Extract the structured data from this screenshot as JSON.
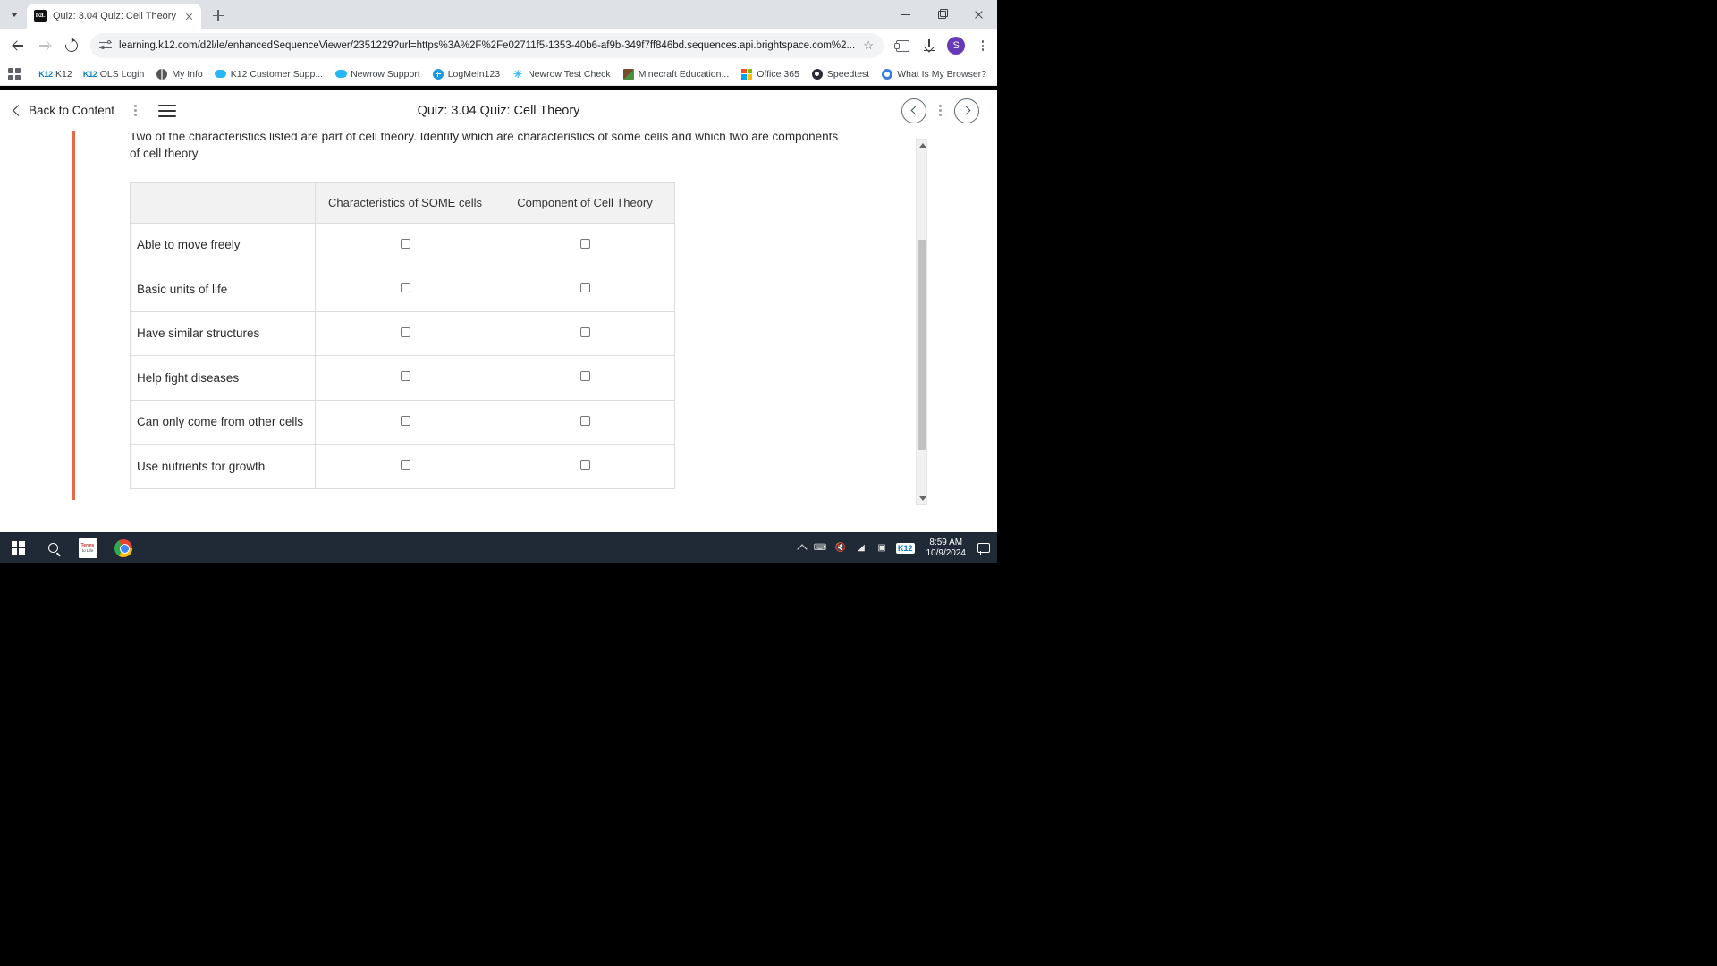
{
  "browser": {
    "tab": {
      "title": "Quiz: 3.04 Quiz: Cell Theory",
      "favicon_label": "D2L",
      "favicon_name": "d2l-favicon"
    },
    "new_tab_label": "+",
    "window_controls": {
      "minimize": "minimize",
      "maximize": "maximize",
      "close": "close"
    },
    "nav": {
      "back": "back",
      "forward": "forward",
      "reload": "reload"
    },
    "omnibox": {
      "url": "learning.k12.com/d2l/le/enhancedSequenceViewer/2351229?url=https%3A%2F%2Fe02711f5-1353-40b6-af9b-349f7ff846bd.sequences.api.brightspace.com%2...",
      "site_info_icon": "site-settings-icon",
      "star_label": "☆"
    },
    "actions": {
      "extensions": "extensions",
      "downloads": "downloads",
      "profile_initial": "S",
      "menu": "chrome-menu"
    },
    "bookmarks": [
      {
        "label": "K12",
        "icon": "k12-icon"
      },
      {
        "label": "OLS Login",
        "icon": "k12-icon"
      },
      {
        "label": "My Info",
        "icon": "globe-icon"
      },
      {
        "label": "K12 Customer Supp...",
        "icon": "cloud-icon"
      },
      {
        "label": "Newrow Support",
        "icon": "cloud-icon"
      },
      {
        "label": "LogMeIn123",
        "icon": "plus-circle-icon"
      },
      {
        "label": "Newrow Test Check",
        "icon": "sparkle-icon"
      },
      {
        "label": "Minecraft Education...",
        "icon": "minecraft-icon"
      },
      {
        "label": "Office 365",
        "icon": "microsoft-icon"
      },
      {
        "label": "Speedtest",
        "icon": "speedtest-icon"
      },
      {
        "label": "What Is My Browser?",
        "icon": "browser-icon"
      }
    ]
  },
  "app_header": {
    "back_label": "Back to Content",
    "title": "Quiz: 3.04 Quiz: Cell Theory",
    "menu_icon": "hamburger-icon",
    "kebab_icon": "more-options-icon",
    "prev_label": "previous",
    "next_label": "next"
  },
  "question": {
    "prompt_line1": "Two of the characteristics listed are part of cell theory. Identify which are characteristics of some cells and which two are components",
    "prompt_line2": "of cell theory.",
    "table": {
      "corner_header": "",
      "columns": [
        "Characteristics of SOME cells",
        "Component of Cell Theory"
      ],
      "rows": [
        {
          "label": "Able to move freely",
          "checked": [
            false,
            false
          ]
        },
        {
          "label": "Basic units of life",
          "checked": [
            false,
            false
          ]
        },
        {
          "label": "Have similar structures",
          "checked": [
            false,
            false
          ]
        },
        {
          "label": "Help fight diseases",
          "checked": [
            false,
            false
          ]
        },
        {
          "label": "Can only come from other cells",
          "checked": [
            false,
            false
          ]
        },
        {
          "label": "Use nutrients for growth",
          "checked": [
            false,
            false
          ]
        }
      ]
    }
  },
  "progress": {
    "segments": 8,
    "active_index": 7,
    "accent": "#006fbf"
  },
  "taskbar": {
    "start_label": "start",
    "search_label": "search",
    "apps": [
      {
        "name": "terms-to-life-app",
        "line1": "Terms",
        "line2": "to Life"
      },
      {
        "name": "google-chrome-app",
        "line1": "",
        "line2": ""
      }
    ],
    "tray": {
      "k12_badge": "K12",
      "time": "8:59 AM",
      "date": "10/9/2024"
    }
  }
}
